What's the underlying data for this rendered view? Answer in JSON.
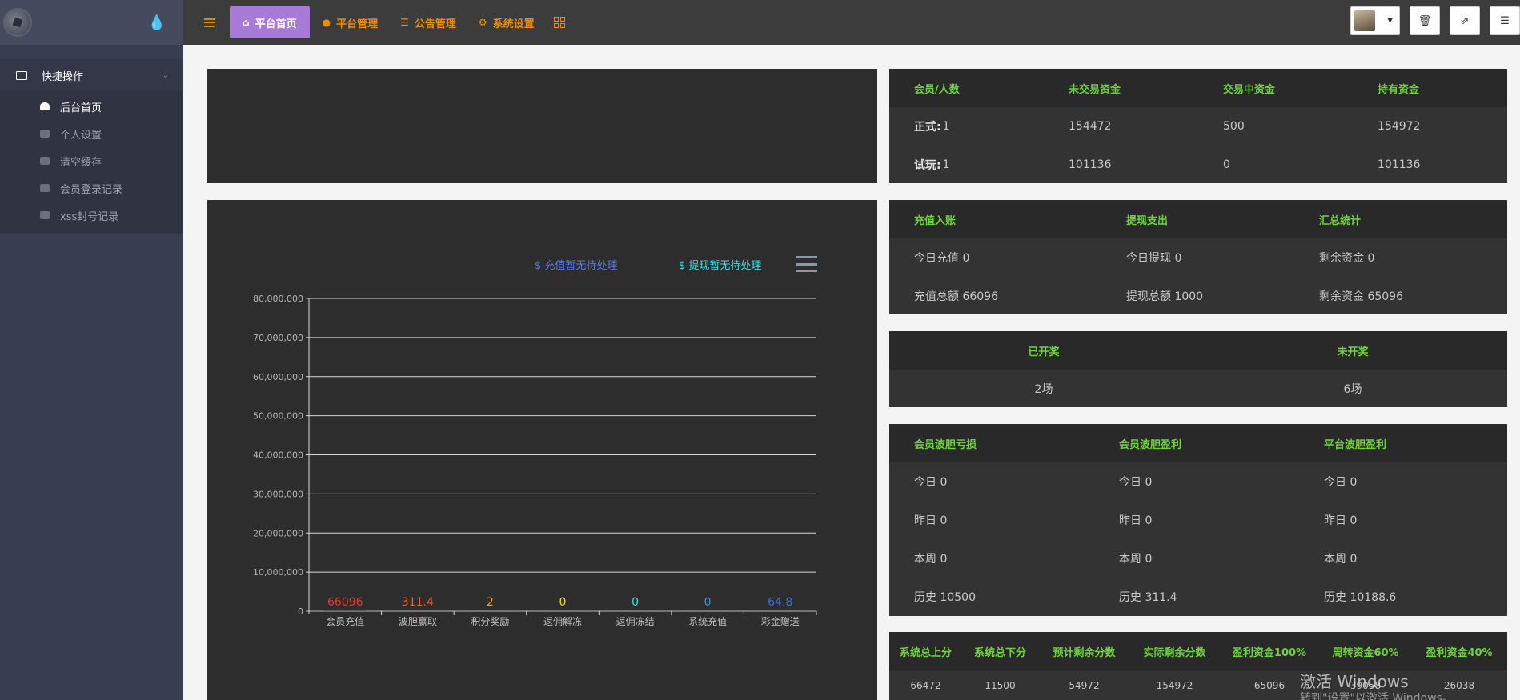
{
  "sidebar": {
    "group_label": "快捷操作",
    "items": [
      {
        "label": "后台首页",
        "icon": "dashboard-icon",
        "active": true
      },
      {
        "label": "个人设置",
        "icon": "user-icon",
        "active": false
      },
      {
        "label": "清空缓存",
        "icon": "trash-icon",
        "active": false
      },
      {
        "label": "会员登录记录",
        "icon": "list-icon",
        "active": false
      },
      {
        "label": "xss封号记录",
        "icon": "plane-icon",
        "active": false
      }
    ]
  },
  "topbar": {
    "nav": [
      {
        "label": "平台首页",
        "icon": "home-icon",
        "active": true
      },
      {
        "label": "平台管理",
        "icon": "user-icon",
        "active": false
      },
      {
        "label": "公告管理",
        "icon": "list-icon",
        "active": false
      },
      {
        "label": "系统设置",
        "icon": "gear-icon",
        "active": false
      }
    ],
    "accent_color": "#f08c00",
    "active_color": "#a67ad6"
  },
  "funds_table": {
    "headers": [
      "会员/人数",
      "未交易资金",
      "交易中资金",
      "持有资金"
    ],
    "rows": [
      {
        "label": "正式:",
        "count": "1",
        "values": [
          "154472",
          "500",
          "154972"
        ]
      },
      {
        "label": "试玩:",
        "count": "1",
        "values": [
          "101136",
          "0",
          "101136"
        ]
      }
    ]
  },
  "cash_table": {
    "headers": [
      "充值入账",
      "提现支出",
      "汇总统计"
    ],
    "rows": [
      [
        "今日充值 0",
        "今日提现 0",
        "剩余资金 0"
      ],
      [
        "充值总额 66096",
        "提现总额 1000",
        "剩余资金 65096"
      ]
    ]
  },
  "draw_table": {
    "headers": [
      "已开奖",
      "未开奖"
    ],
    "rows": [
      [
        "2场",
        "6场"
      ]
    ]
  },
  "profit_table": {
    "headers": [
      "会员波胆亏损",
      "会员波胆盈利",
      "平台波胆盈利"
    ],
    "rows": [
      [
        "今日 0",
        "今日 0",
        "今日 0"
      ],
      [
        "昨日 0",
        "昨日 0",
        "昨日 0"
      ],
      [
        "本周 0",
        "本周 0",
        "本周 0"
      ],
      [
        "历史 10500",
        "历史 311.4",
        "历史 10188.6"
      ]
    ]
  },
  "score_table": {
    "headers": [
      "系统总上分",
      "系统总下分",
      "预计剩余分数",
      "实际剩余分数",
      "盈利资金100%",
      "周转资金60%",
      "盈利资金40%"
    ],
    "rows": [
      [
        "66472",
        "11500",
        "54972",
        "154972",
        "65096",
        "39058",
        "26038"
      ]
    ]
  },
  "chart_legend": {
    "deposit": "$ 充值暂无待处理",
    "withdraw": "$ 提现暂无待处理"
  },
  "chart_data": {
    "type": "bar",
    "categories": [
      "会员充值",
      "波胆赢取",
      "积分奖励",
      "返佣解冻",
      "返佣冻结",
      "系统充值",
      "彩金赠送"
    ],
    "values": [
      66096,
      311.4,
      2,
      0,
      0,
      0,
      64.8
    ],
    "value_labels": [
      "66096",
      "311.4",
      "2",
      "0",
      "0",
      "0",
      "64.8"
    ],
    "value_colors": [
      "#e53935",
      "#ef5a2a",
      "#f0a020",
      "#f5e000",
      "#39e0e6",
      "#2f9ae0",
      "#3d6fe0"
    ],
    "ylim": [
      0,
      80000000
    ],
    "yticks": [
      "0",
      "10,000,000",
      "20,000,000",
      "30,000,000",
      "40,000,000",
      "50,000,000",
      "60,000,000",
      "70,000,000",
      "80,000,000"
    ],
    "grid": true
  },
  "watermark": {
    "line1": "激活 Windows",
    "line2": "转到\"设置\"以激活 Windows。"
  }
}
